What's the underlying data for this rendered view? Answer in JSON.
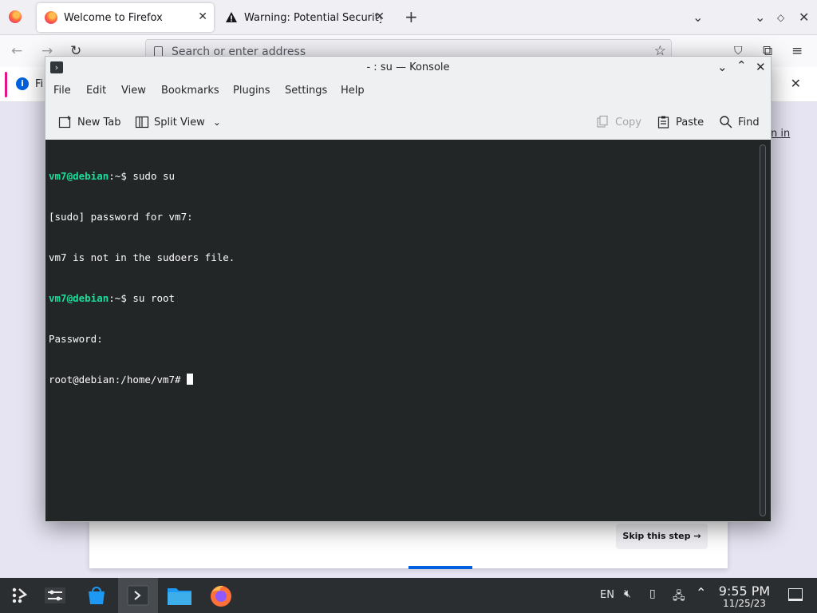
{
  "firefox": {
    "tabs": [
      {
        "title": "Welcome to Firefox",
        "close": "✕"
      },
      {
        "title": "Warning: Potential Security",
        "close": "✕"
      }
    ],
    "new_tab_icon": "plus-icon",
    "address_placeholder": "Search or enter address",
    "notification_text": "Fi",
    "page_link": "n in",
    "skip_label": "Skip this step →",
    "progress": 0.1
  },
  "konsole": {
    "title": "- : su — Konsole",
    "menu": [
      "File",
      "Edit",
      "View",
      "Bookmarks",
      "Plugins",
      "Settings",
      "Help"
    ],
    "toolbar": {
      "new_tab": "New Tab",
      "split_view": "Split View",
      "copy": "Copy",
      "paste": "Paste",
      "find": "Find"
    },
    "terminal": {
      "lines": [
        {
          "user": "vm7@debian",
          "path": ":~$ ",
          "text": "sudo su"
        },
        {
          "user": "",
          "path": "",
          "text": "[sudo] password for vm7:"
        },
        {
          "user": "",
          "path": "",
          "text": "vm7 is not in the sudoers file."
        },
        {
          "user": "vm7@debian",
          "path": ":~$ ",
          "text": "su root"
        },
        {
          "user": "",
          "path": "",
          "text": "Password:"
        },
        {
          "user": "",
          "path": "",
          "text": "root@debian:/home/vm7# "
        }
      ]
    }
  },
  "taskbar": {
    "keyboard_layout": "EN",
    "time": "9:55 PM",
    "date": "11/25/23",
    "apps": [
      "app-launcher-icon",
      "system-settings-icon",
      "discover-store-icon",
      "konsole-icon",
      "dolphin-files-icon",
      "firefox-icon"
    ]
  },
  "colors": {
    "terminal_bg": "#232627",
    "prompt_green": "#1cdc9a",
    "taskbar_bg": "#2b2e31",
    "accent_blue": "#0060df"
  }
}
